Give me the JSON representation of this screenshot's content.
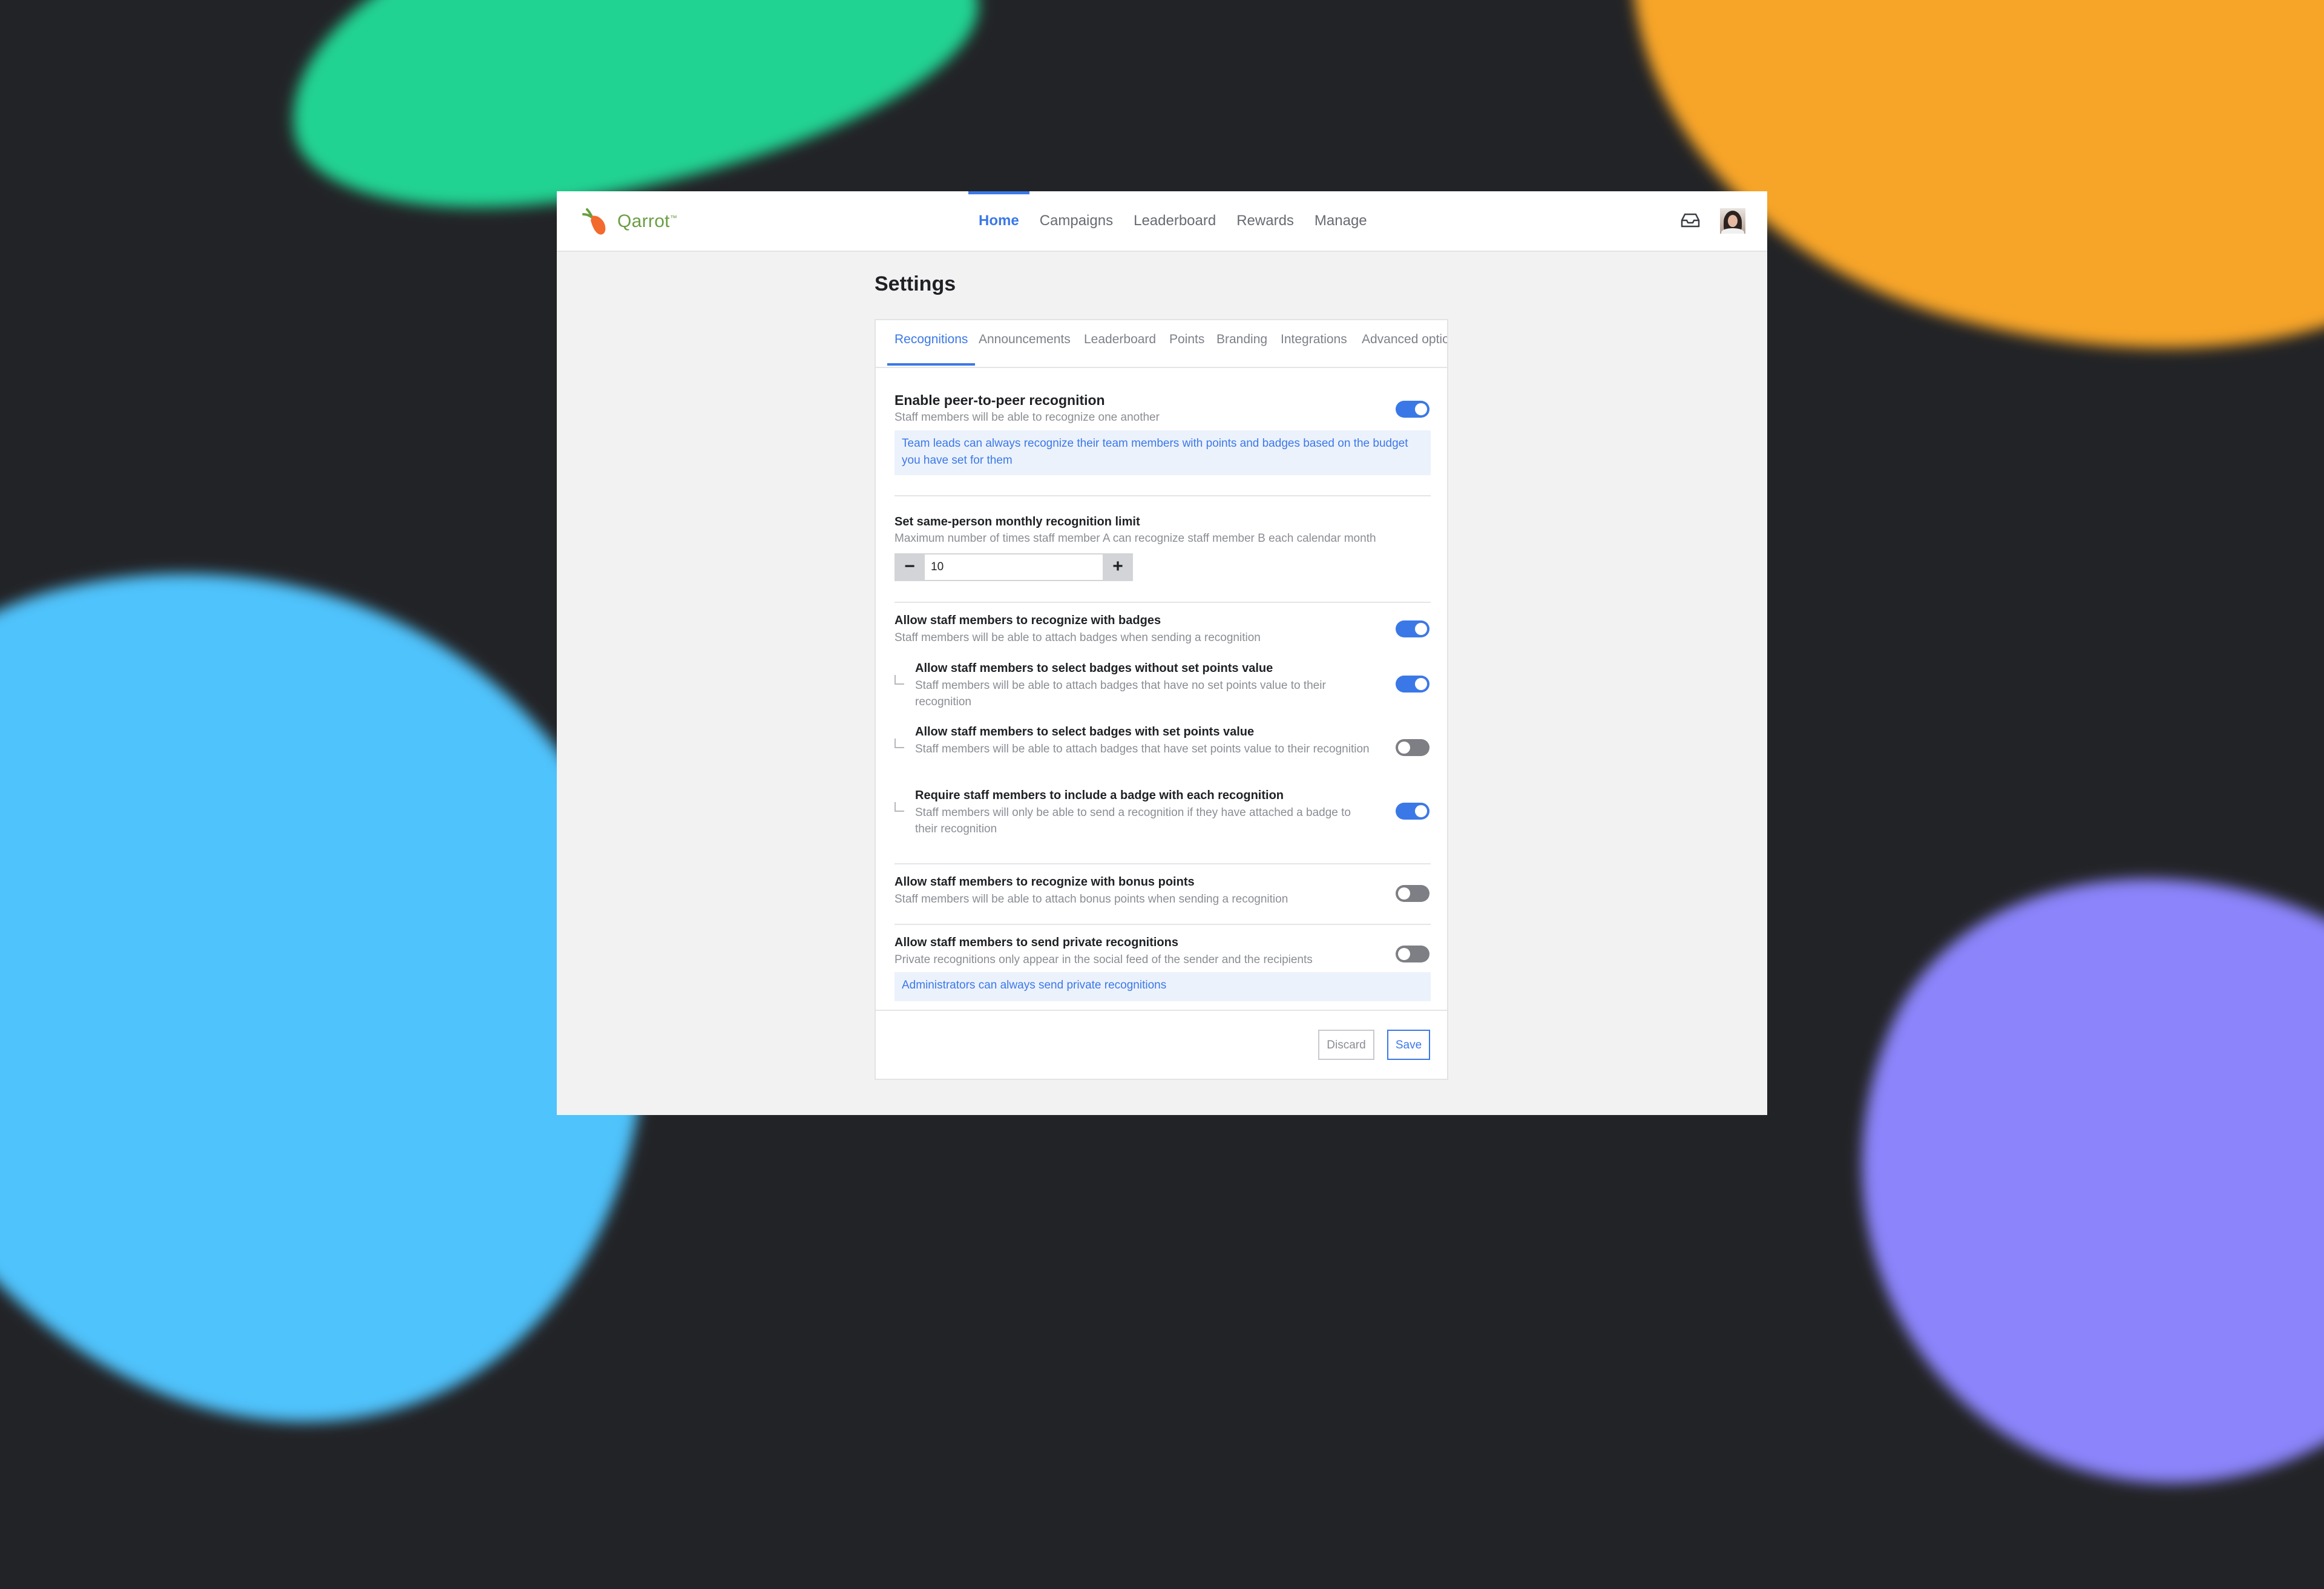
{
  "app": {
    "brand": "Qarrot",
    "brand_mark": "™"
  },
  "nav": {
    "items": [
      {
        "label": "Home",
        "active": true
      },
      {
        "label": "Campaigns"
      },
      {
        "label": "Leaderboard"
      },
      {
        "label": "Rewards"
      },
      {
        "label": "Manage"
      }
    ]
  },
  "header": {
    "inbox_icon": "inbox-icon",
    "avatar": "user-avatar"
  },
  "page": {
    "title": "Settings"
  },
  "tabs": [
    {
      "label": "Recognitions",
      "active": true
    },
    {
      "label": "Announcements"
    },
    {
      "label": "Leaderboard"
    },
    {
      "label": "Points"
    },
    {
      "label": "Branding"
    },
    {
      "label": "Integrations"
    },
    {
      "label": "Advanced optio"
    }
  ],
  "settings": {
    "peer": {
      "title": "Enable peer-to-peer recognition",
      "desc": "Staff members will be able to recognize one another",
      "note": "Team leads can always recognize their team members with points and badges based on the budget you have set for them",
      "enabled": true
    },
    "limit": {
      "title": "Set same-person monthly recognition limit",
      "desc": "Maximum number of times staff member A can recognize staff member B each calendar month",
      "value": "10",
      "minus": "−",
      "plus": "+"
    },
    "badges": {
      "title": "Allow staff members to recognize with badges",
      "desc": "Staff members will be able to attach badges when sending a recognition",
      "enabled": true,
      "sub": [
        {
          "title": "Allow staff members to select badges without set points value",
          "desc": "Staff members will be able to attach badges that have no set points value to their recognition",
          "enabled": true
        },
        {
          "title": "Allow staff members to select badges with set points value",
          "desc": "Staff members will be able to attach badges that have set points value to their recognition",
          "enabled": false
        },
        {
          "title": "Require staff members to include a badge with each recognition",
          "desc": "Staff members will only be able to send a recognition if they have attached a badge to their recognition",
          "enabled": true
        }
      ]
    },
    "bonus": {
      "title": "Allow staff members to recognize with bonus points",
      "desc": "Staff members will be able to attach bonus points when sending a recognition",
      "enabled": false
    },
    "private": {
      "title": "Allow staff members to send private recognitions",
      "desc": "Private recognitions only appear in the social feed of the sender and the recipients",
      "note": "Administrators can always send private recognitions",
      "enabled": false
    }
  },
  "actions": {
    "discard": "Discard",
    "save": "Save"
  },
  "colors": {
    "accent": "#3b78e7",
    "toggle_off": "#7d7f84",
    "brand_green": "#6a9e43",
    "brand_orange": "#f26a2e"
  }
}
